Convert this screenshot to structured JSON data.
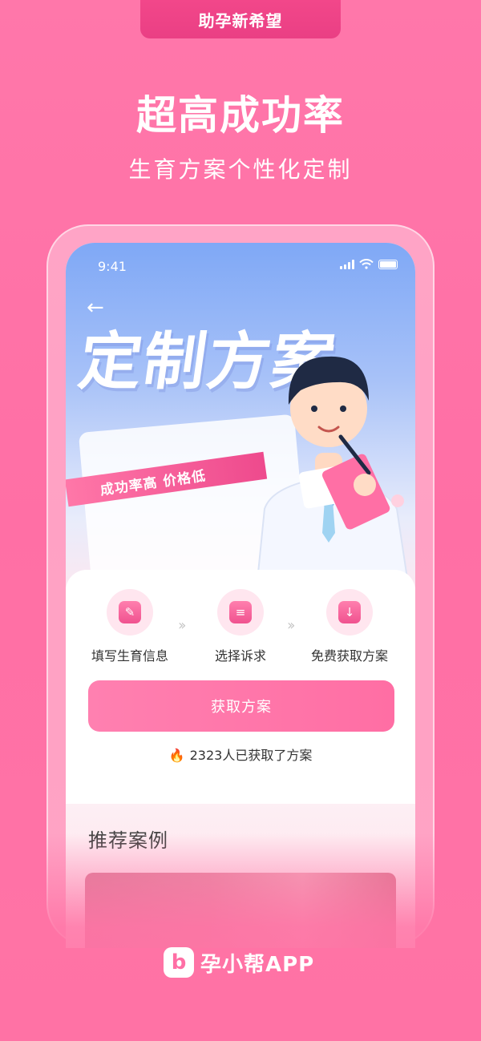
{
  "top_badge": "助孕新希望",
  "headline": "超高成功率",
  "subline": "生育方案个性化定制",
  "phone": {
    "status_time": "9:41",
    "back_icon": "arrow-left-icon",
    "hero_title": "定制方案",
    "ribbon_text": "成功率高  价格低",
    "steps": [
      {
        "label": "填写生育信息",
        "icon": "pencil-icon"
      },
      {
        "label": "选择诉求",
        "icon": "list-icon"
      },
      {
        "label": "免费获取方案",
        "icon": "download-icon"
      }
    ],
    "cta_label": "获取方案",
    "counter_text": "2323人已获取了方案",
    "section_title": "推荐案例"
  },
  "brand": {
    "mark": "b",
    "name": "孕小帮APP"
  },
  "colors": {
    "background": "#ff72a5",
    "accent": "#ee4a8d",
    "cta": "#ff78ab"
  }
}
